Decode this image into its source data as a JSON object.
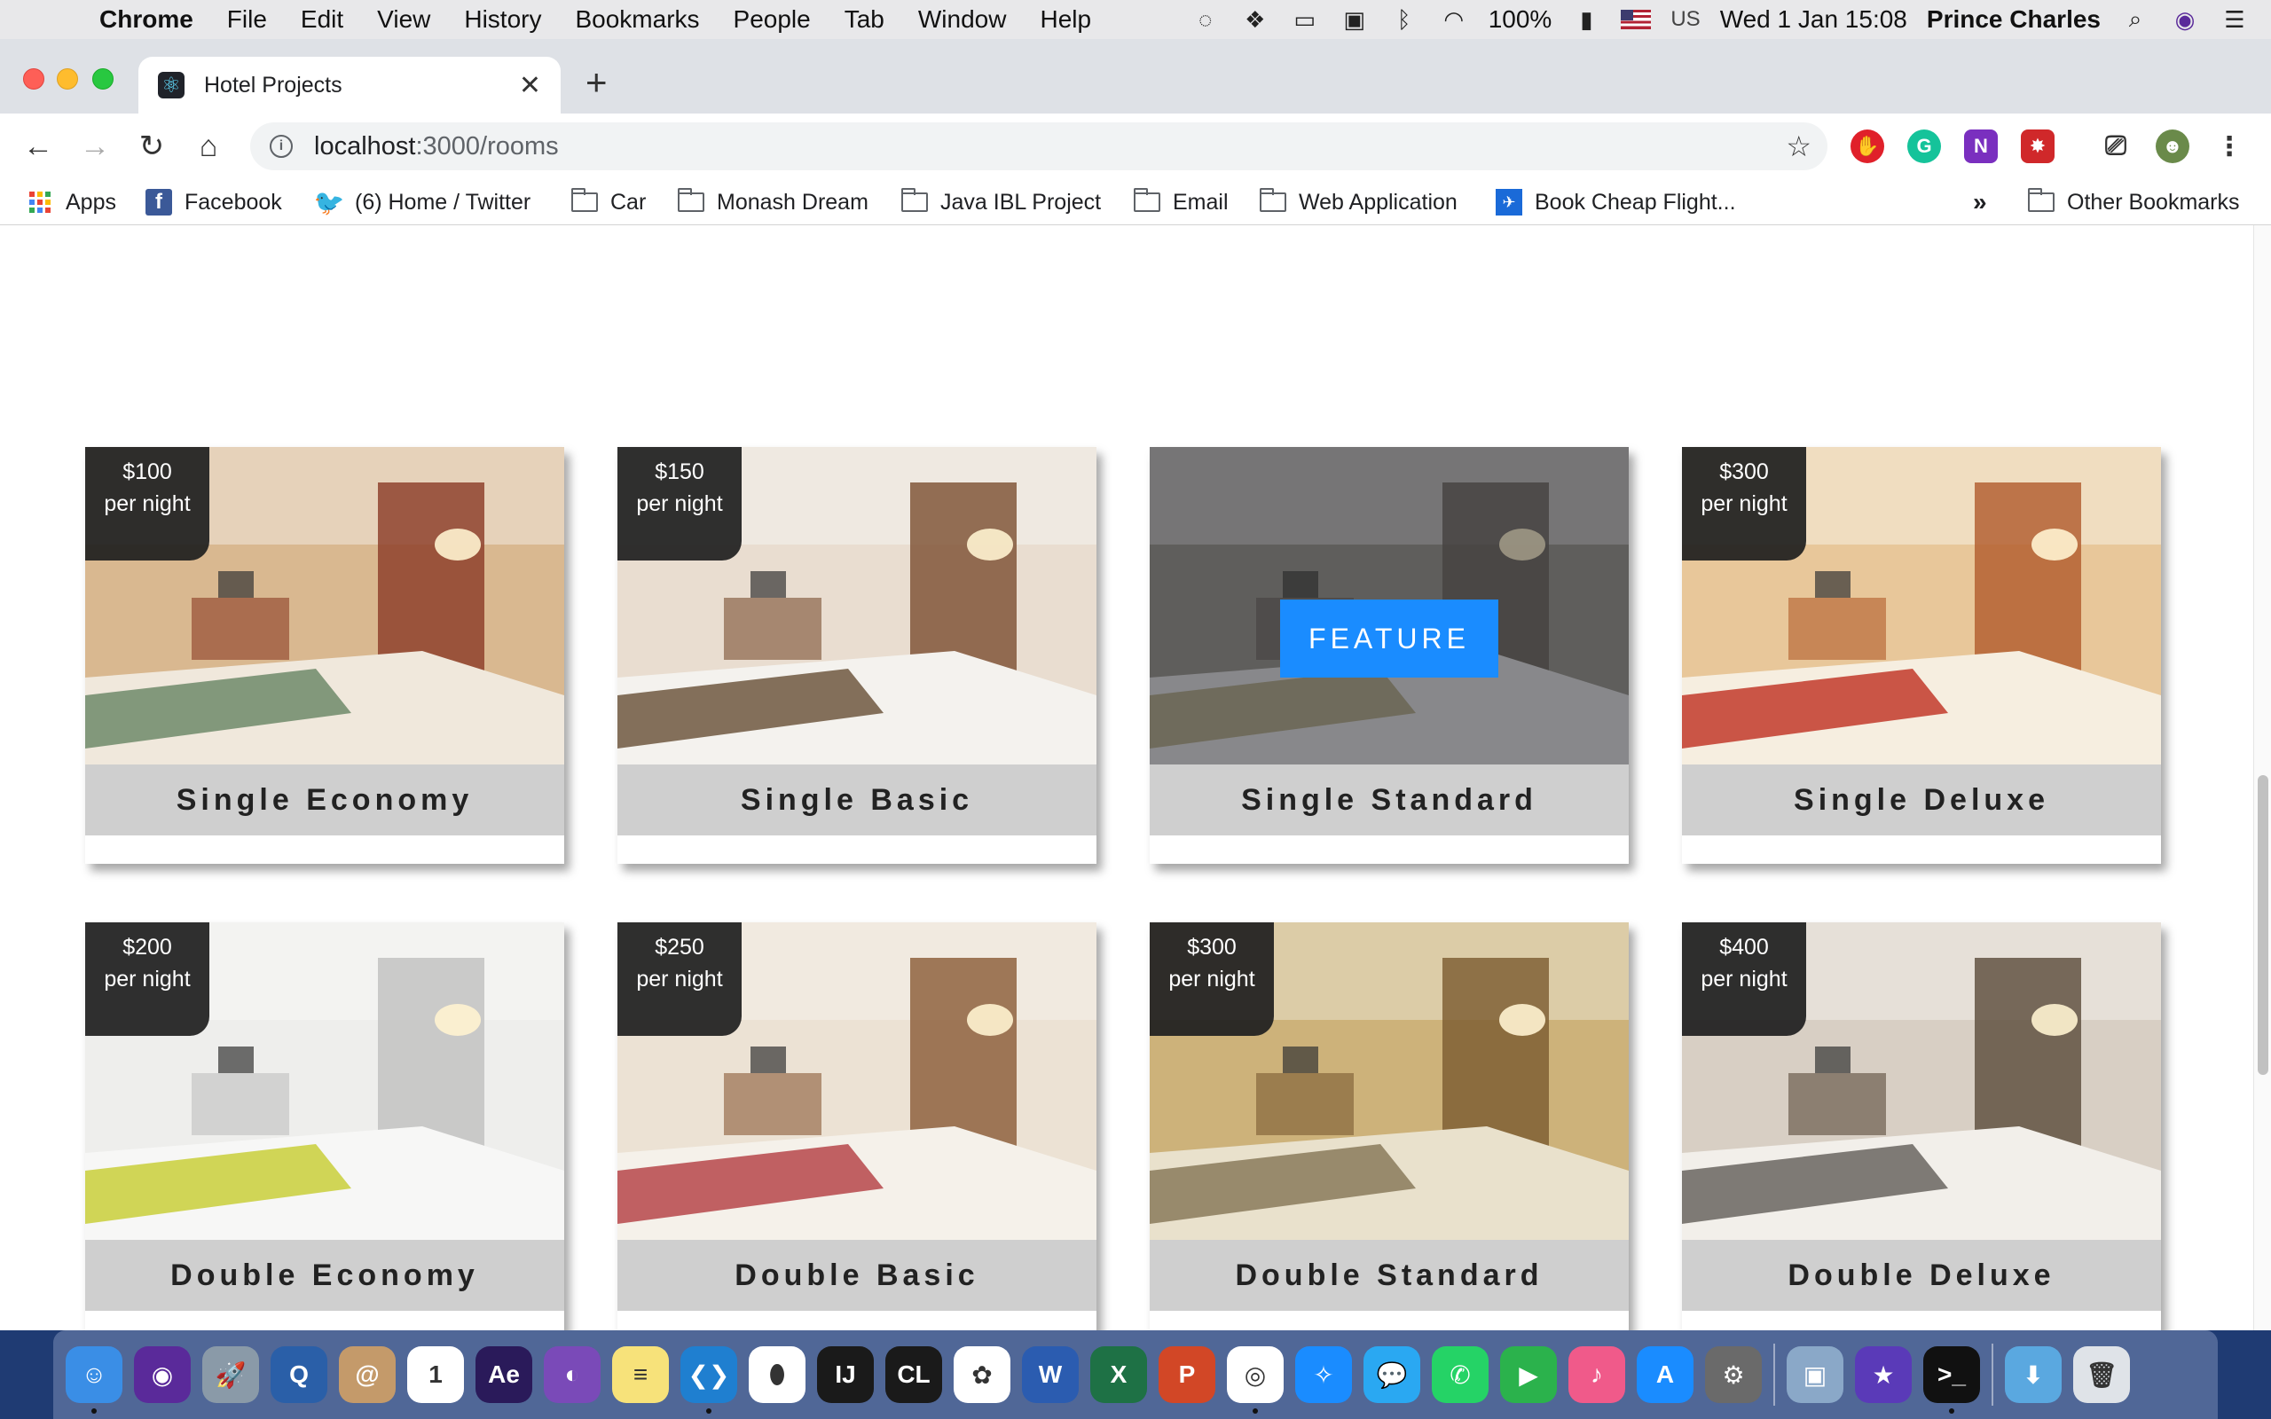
{
  "menubar": {
    "app_name": "Chrome",
    "items": [
      "File",
      "Edit",
      "View",
      "History",
      "Bookmarks",
      "People",
      "Tab",
      "Window",
      "Help"
    ],
    "battery": "100%",
    "input_source": "US",
    "datetime": "Wed 1 Jan  15:08",
    "user": "Prince Charles"
  },
  "browser": {
    "tab_title": "Hotel Projects",
    "url_host": "localhost",
    "url_path": ":3000/rooms",
    "new_tab": "+",
    "bookmarks": [
      {
        "label": "Apps",
        "icon": "apps-grid-icon"
      },
      {
        "label": "Facebook",
        "icon": "facebook-icon"
      },
      {
        "label": "(6) Home / Twitter",
        "icon": "twitter-icon"
      },
      {
        "label": "Car",
        "icon": "folder-icon"
      },
      {
        "label": "Monash Dream",
        "icon": "folder-icon"
      },
      {
        "label": "Java IBL Project",
        "icon": "folder-icon"
      },
      {
        "label": "Email",
        "icon": "folder-icon"
      },
      {
        "label": "Web Application",
        "icon": "folder-icon"
      },
      {
        "label": "Book Cheap Flight...",
        "icon": "flight-icon"
      }
    ],
    "overflow": "»",
    "other_bookmarks": "Other Bookmarks"
  },
  "rooms": [
    {
      "name": "Single Economy",
      "price": "$100",
      "per": "per night",
      "featured": false,
      "palette": [
        "#d9b890",
        "#8a3a25",
        "#f0e8dc",
        "#6f8a6a"
      ]
    },
    {
      "name": "Single Basic",
      "price": "$150",
      "per": "per night",
      "featured": false,
      "palette": [
        "#e9ddd0",
        "#7a4e30",
        "#f4f2ee",
        "#6e5840"
      ]
    },
    {
      "name": "Single Standard",
      "price": "",
      "per": "",
      "featured": true,
      "feature_label": "FEATURE",
      "palette": [
        "#8c8a88",
        "#5d5653",
        "#d8d8dc",
        "#a29a78"
      ]
    },
    {
      "name": "Single Deluxe",
      "price": "$300",
      "per": "per night",
      "featured": false,
      "palette": [
        "#e8c79a",
        "#b05a2a",
        "#f6eee0",
        "#c23a2a"
      ]
    },
    {
      "name": "Double Economy",
      "price": "$200",
      "per": "per night",
      "featured": false,
      "palette": [
        "#eeeeec",
        "#bfbfbf",
        "#f7f7f6",
        "#c9cf3a"
      ]
    },
    {
      "name": "Double Basic",
      "price": "$250",
      "per": "per night",
      "featured": false,
      "palette": [
        "#ece2d4",
        "#8a5a35",
        "#f5f1ea",
        "#b6474a"
      ]
    },
    {
      "name": "Double Standard",
      "price": "$300",
      "per": "per night",
      "featured": false,
      "palette": [
        "#cdb27a",
        "#7a5a30",
        "#e9e1cc",
        "#8a7a5a"
      ]
    },
    {
      "name": "Double Deluxe",
      "price": "$400",
      "per": "per night",
      "featured": false,
      "palette": [
        "#d8cfc4",
        "#5a4a3a",
        "#f2efea",
        "#6a6560"
      ]
    }
  ],
  "dock": [
    {
      "name": "finder-icon",
      "color": "#3a8ee6",
      "glyph": "☺",
      "running": true
    },
    {
      "name": "siri-icon",
      "color": "#5a2a9a",
      "glyph": "◉",
      "running": false
    },
    {
      "name": "launchpad-icon",
      "color": "#8a9aa8",
      "glyph": "🚀",
      "running": false
    },
    {
      "name": "quicktime-icon",
      "color": "#2a5fa8",
      "glyph": "Q",
      "running": false
    },
    {
      "name": "contacts-icon",
      "color": "#c49a6a",
      "glyph": "@",
      "running": false
    },
    {
      "name": "calendar-icon",
      "color": "#ffffff",
      "glyph": "1",
      "running": false
    },
    {
      "name": "after-effects-icon",
      "color": "#2a1a5a",
      "glyph": "Ae",
      "running": false
    },
    {
      "name": "github-desktop-icon",
      "color": "#7a4ab8",
      "glyph": "◐",
      "running": false
    },
    {
      "name": "notes-icon",
      "color": "#f7e27a",
      "glyph": "≡",
      "running": false
    },
    {
      "name": "vscode-icon",
      "color": "#1f7fd0",
      "glyph": "❮❯",
      "running": true
    },
    {
      "name": "mongodb-icon",
      "color": "#ffffff",
      "glyph": "⬮",
      "running": false
    },
    {
      "name": "intellij-icon",
      "color": "#1a1a1a",
      "glyph": "IJ",
      "running": false
    },
    {
      "name": "clion-icon",
      "color": "#1a1a1a",
      "glyph": "CL",
      "running": false
    },
    {
      "name": "photos-icon",
      "color": "#ffffff",
      "glyph": "✿",
      "running": false
    },
    {
      "name": "word-icon",
      "color": "#2b5cb0",
      "glyph": "W",
      "running": false
    },
    {
      "name": "excel-icon",
      "color": "#1e7145",
      "glyph": "X",
      "running": false
    },
    {
      "name": "powerpoint-icon",
      "color": "#d24726",
      "glyph": "P",
      "running": false
    },
    {
      "name": "chrome-icon",
      "color": "#ffffff",
      "glyph": "◎",
      "running": true
    },
    {
      "name": "safari-icon",
      "color": "#1a8cff",
      "glyph": "✧",
      "running": false
    },
    {
      "name": "messages-icon",
      "color": "#2aa8f2",
      "glyph": "💬",
      "running": false
    },
    {
      "name": "whatsapp-icon",
      "color": "#25d366",
      "glyph": "✆",
      "running": false
    },
    {
      "name": "facetime-icon",
      "color": "#2bb24c",
      "glyph": "▶",
      "running": false
    },
    {
      "name": "itunes-icon",
      "color": "#f05a8a",
      "glyph": "♪",
      "running": false
    },
    {
      "name": "app-store-icon",
      "color": "#1a8cff",
      "glyph": "A",
      "running": false
    },
    {
      "name": "system-preferences-icon",
      "color": "#6a6a6a",
      "glyph": "⚙",
      "running": false
    },
    {
      "name": "preview-icon",
      "color": "#8aa8c8",
      "glyph": "▣",
      "running": false
    },
    {
      "name": "imovie-icon",
      "color": "#5a3ab8",
      "glyph": "★",
      "running": false
    },
    {
      "name": "terminal-icon",
      "color": "#111111",
      "glyph": ">_",
      "running": true
    },
    {
      "name": "downloads-folder-icon",
      "color": "#5aa8e0",
      "glyph": "⬇",
      "running": false
    },
    {
      "name": "trash-icon",
      "color": "#dfe3e8",
      "glyph": "🗑",
      "running": false
    }
  ]
}
